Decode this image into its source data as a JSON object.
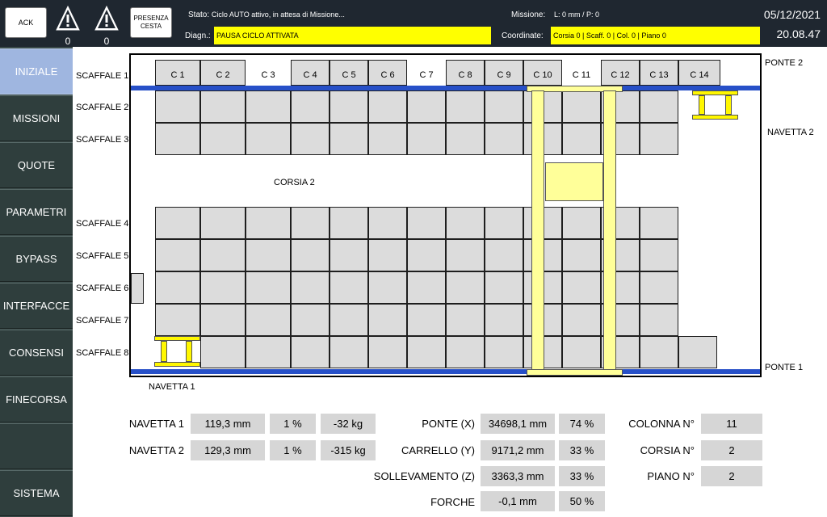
{
  "header": {
    "ack_label": "ACK",
    "alarm_count_1": "0",
    "alarm_count_2": "0",
    "presenza_label": "PRESENZA\nCESTA",
    "stato_label": "Stato:",
    "stato_value": "Ciclo AUTO attivo, in attesa di Missione...",
    "diagn_label": "Diagn.:",
    "diagn_value": "PAUSA CICLO ATTIVATA",
    "missione_label": "Missione:",
    "missione_value": "L: 0 mm / P: 0",
    "coordinate_label": "Coordinate:",
    "coordinate_value": "Corsia 0 | Scaff. 0 | Col. 0 | Piano 0",
    "date": "05/12/2021",
    "time": "20.08.47"
  },
  "sidebar": {
    "items": [
      {
        "label": "INIZIALE"
      },
      {
        "label": "MISSIONI"
      },
      {
        "label": "QUOTE"
      },
      {
        "label": "PARAMETRI"
      },
      {
        "label": "BYPASS"
      },
      {
        "label": "INTERFACCE"
      },
      {
        "label": "CONSENSI"
      },
      {
        "label": "FINECORSA"
      },
      {
        "label": ""
      },
      {
        "label": "SISTEMA"
      }
    ]
  },
  "map": {
    "columns": [
      "C 1",
      "C 2",
      "C 3",
      "C 4",
      "C 5",
      "C 6",
      "C 7",
      "C 8",
      "C 9",
      "C 10",
      "C 11",
      "C 12",
      "C 13",
      "C 14"
    ],
    "shelves": [
      "SCAFFALE 1",
      "SCAFFALE 2",
      "SCAFFALE 3",
      "SCAFFALE 4",
      "SCAFFALE 5",
      "SCAFFALE 6",
      "SCAFFALE 7",
      "SCAFFALE 8"
    ],
    "corsia_label": "CORSIA 2",
    "ponte1_label": "PONTE 1",
    "ponte2_label": "PONTE 2",
    "navetta1_label": "NAVETTA 1",
    "navetta2_label": "NAVETTA 2",
    "colors": {
      "rail": "#2750c8",
      "cell": "#dcdcdc",
      "bridge": "#ffff99",
      "shuttle": "#fff700"
    }
  },
  "readouts": {
    "navetta1": {
      "label": "NAVETTA 1",
      "pos": "119,3 mm",
      "pct": "1 %",
      "load": "-32 kg"
    },
    "navetta2": {
      "label": "NAVETTA 2",
      "pos": "129,3 mm",
      "pct": "1 %",
      "load": "-315 kg"
    },
    "ponte": {
      "label": "PONTE (X)",
      "pos": "34698,1 mm",
      "pct": "74 %"
    },
    "carrello": {
      "label": "CARRELLO (Y)",
      "pos": "9171,2 mm",
      "pct": "33 %"
    },
    "sollevamento": {
      "label": "SOLLEVAMENTO (Z)",
      "pos": "3363,3 mm",
      "pct": "33 %"
    },
    "forche": {
      "label": "FORCHE",
      "pos": "-0,1 mm",
      "pct": "50 %"
    },
    "colonna": {
      "label": "COLONNA N°",
      "value": "11"
    },
    "corsia": {
      "label": "CORSIA N°",
      "value": "2"
    },
    "piano": {
      "label": "PIANO N°",
      "value": "2"
    }
  }
}
